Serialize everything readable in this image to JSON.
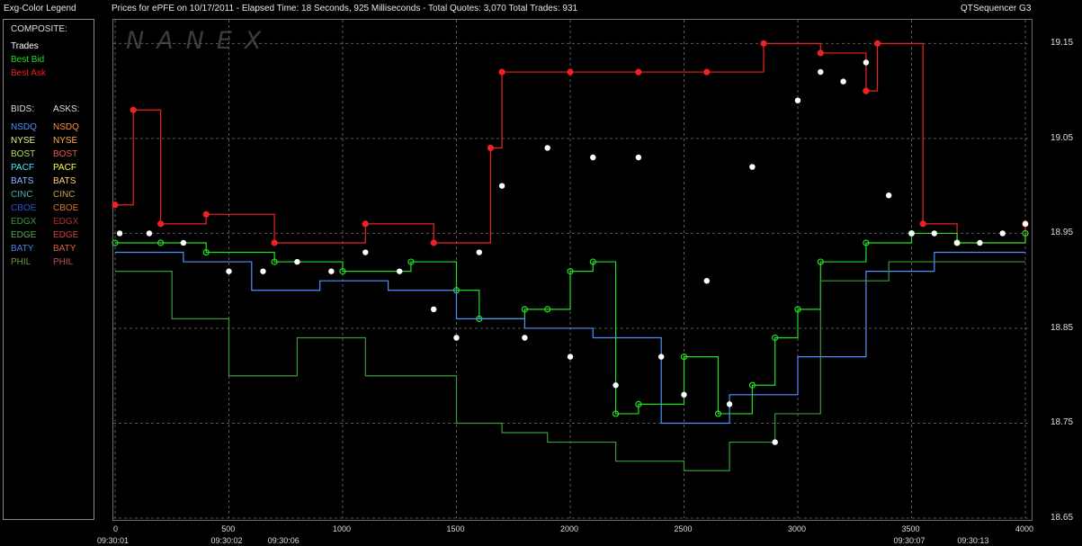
{
  "header": {
    "legend_title": "Exg-Color Legend",
    "chart_title": "Prices for  ePFE  on  10/17/2011  -  Elapsed Time: 18 Seconds, 925 Milliseconds  -  Total Quotes: 3,070  Total Trades: 931",
    "app_name": "QTSequencer G3"
  },
  "legend": {
    "composite_label": "COMPOSITE:",
    "composite": [
      {
        "label": "Trades",
        "color": "#ffffff"
      },
      {
        "label": "Best Bid",
        "color": "#22dd22"
      },
      {
        "label": "Best Ask",
        "color": "#ee2222"
      }
    ],
    "bids_label": "BIDS:",
    "asks_label": "ASKS:",
    "exchanges": [
      {
        "bid": "NSDQ",
        "bid_color": "#4f8fff",
        "ask": "NSDQ",
        "ask_color": "#ff8c3a"
      },
      {
        "bid": "NYSE",
        "bid_color": "#e8f08a",
        "ask": "NYSE",
        "ask_color": "#ffb040"
      },
      {
        "bid": "BOST",
        "bid_color": "#a8e060",
        "ask": "BOST",
        "ask_color": "#e85a50"
      },
      {
        "bid": "PACF",
        "bid_color": "#50e8ff",
        "ask": "PACF",
        "ask_color": "#ffff40"
      },
      {
        "bid": "BATS",
        "bid_color": "#8ab8ff",
        "ask": "BATS",
        "ask_color": "#ffd27a"
      },
      {
        "bid": "CINC",
        "bid_color": "#4fb0a8",
        "ask": "CINC",
        "ask_color": "#c8a050"
      },
      {
        "bid": "CBOE",
        "bid_color": "#3050d0",
        "ask": "CBOE",
        "ask_color": "#d87820"
      },
      {
        "bid": "EDGX",
        "bid_color": "#3a9a3a",
        "ask": "EDGX",
        "ask_color": "#b03030"
      },
      {
        "bid": "EDGE",
        "bid_color": "#5aaa5a",
        "ask": "EDGE",
        "ask_color": "#d04040"
      },
      {
        "bid": "BATY",
        "bid_color": "#5080e0",
        "ask": "BATY",
        "ask_color": "#e06040"
      },
      {
        "bid": "PHIL",
        "bid_color": "#6a9a40",
        "ask": "PHIL",
        "ask_color": "#c05050"
      }
    ]
  },
  "watermark": "NANEX",
  "chart_data": {
    "type": "line",
    "title": "Prices for  ePFE  on  10/17/2011",
    "xlabel": "",
    "ylabel": "",
    "xlim": [
      0,
      4050
    ],
    "ylim": [
      18.65,
      19.2
    ],
    "y_ticks": [
      "19.15",
      "19.05",
      "18.95",
      "18.85",
      "18.75",
      "18.65"
    ],
    "y_tick_values": [
      19.15,
      19.05,
      18.95,
      18.85,
      18.75,
      18.65
    ],
    "x_ticks": [
      "0",
      "500",
      "1000",
      "1500",
      "2000",
      "2500",
      "3000",
      "3500",
      "4000"
    ],
    "x_tick_values": [
      0,
      500,
      1000,
      1500,
      2000,
      2500,
      3000,
      3500,
      4000
    ],
    "time_labels": [
      {
        "x": 0,
        "label": "09:30:01"
      },
      {
        "x": 500,
        "label": "09:30:02"
      },
      {
        "x": 750,
        "label": "09:30:06"
      },
      {
        "x": 3500,
        "label": "09:30:07"
      },
      {
        "x": 3780,
        "label": "09:30:13"
      }
    ],
    "grid": true,
    "series": [
      {
        "name": "Best Ask",
        "color": "#ee2222",
        "x": [
          0,
          80,
          200,
          400,
          700,
          1100,
          1400,
          1650,
          1700,
          2000,
          2300,
          2600,
          2850,
          3100,
          3300,
          3350,
          3550,
          3700,
          4000
        ],
        "values": [
          18.98,
          19.08,
          18.96,
          18.97,
          18.94,
          18.96,
          18.94,
          19.04,
          19.12,
          19.12,
          19.12,
          19.12,
          19.15,
          19.14,
          19.1,
          19.15,
          18.96,
          18.94,
          18.96
        ]
      },
      {
        "name": "Best Bid",
        "color": "#22dd22",
        "x": [
          0,
          200,
          400,
          700,
          1000,
          1300,
          1500,
          1600,
          1800,
          1900,
          2000,
          2100,
          2200,
          2300,
          2500,
          2650,
          2800,
          2900,
          3000,
          3100,
          3300,
          3500,
          3700,
          4000
        ],
        "values": [
          18.94,
          18.94,
          18.93,
          18.92,
          18.91,
          18.92,
          18.89,
          18.86,
          18.87,
          18.87,
          18.91,
          18.92,
          18.76,
          18.77,
          18.82,
          18.76,
          18.79,
          18.84,
          18.87,
          18.92,
          18.94,
          18.95,
          18.94,
          18.95
        ]
      },
      {
        "name": "Trades",
        "color": "#ffffff",
        "x": [
          20,
          150,
          300,
          500,
          650,
          800,
          950,
          1100,
          1250,
          1400,
          1500,
          1600,
          1700,
          1800,
          1900,
          2000,
          2100,
          2200,
          2300,
          2400,
          2500,
          2600,
          2700,
          2800,
          2900,
          3000,
          3100,
          3200,
          3300,
          3400,
          3500,
          3600,
          3700,
          3800,
          3900,
          4000
        ],
        "values": [
          18.95,
          18.95,
          18.94,
          18.91,
          18.91,
          18.92,
          18.91,
          18.93,
          18.91,
          18.87,
          18.84,
          18.93,
          19.0,
          18.84,
          19.04,
          18.82,
          19.03,
          18.79,
          19.03,
          18.82,
          18.78,
          18.9,
          18.77,
          19.02,
          18.73,
          19.09,
          19.12,
          19.11,
          19.13,
          18.99,
          18.95,
          18.95,
          18.94,
          18.94,
          18.95,
          18.96
        ]
      },
      {
        "name": "NSDQ",
        "color": "#4f8fff",
        "x": [
          0,
          300,
          600,
          900,
          1200,
          1500,
          1800,
          2100,
          2400,
          2700,
          3000,
          3300,
          3600,
          4000
        ],
        "values": [
          18.93,
          18.92,
          18.89,
          18.9,
          18.89,
          18.86,
          18.85,
          18.84,
          18.75,
          18.78,
          18.82,
          18.91,
          18.93,
          18.93
        ]
      },
      {
        "name": "EDGX",
        "color": "#3a9a3a",
        "x": [
          0,
          250,
          500,
          800,
          1100,
          1500,
          1700,
          1900,
          2200,
          2500,
          2700,
          2900,
          3100,
          3400,
          3700,
          4000
        ],
        "values": [
          18.91,
          18.86,
          18.8,
          18.84,
          18.8,
          18.75,
          18.74,
          18.73,
          18.71,
          18.7,
          18.73,
          18.76,
          18.9,
          18.92,
          18.92,
          18.92
        ]
      }
    ]
  }
}
